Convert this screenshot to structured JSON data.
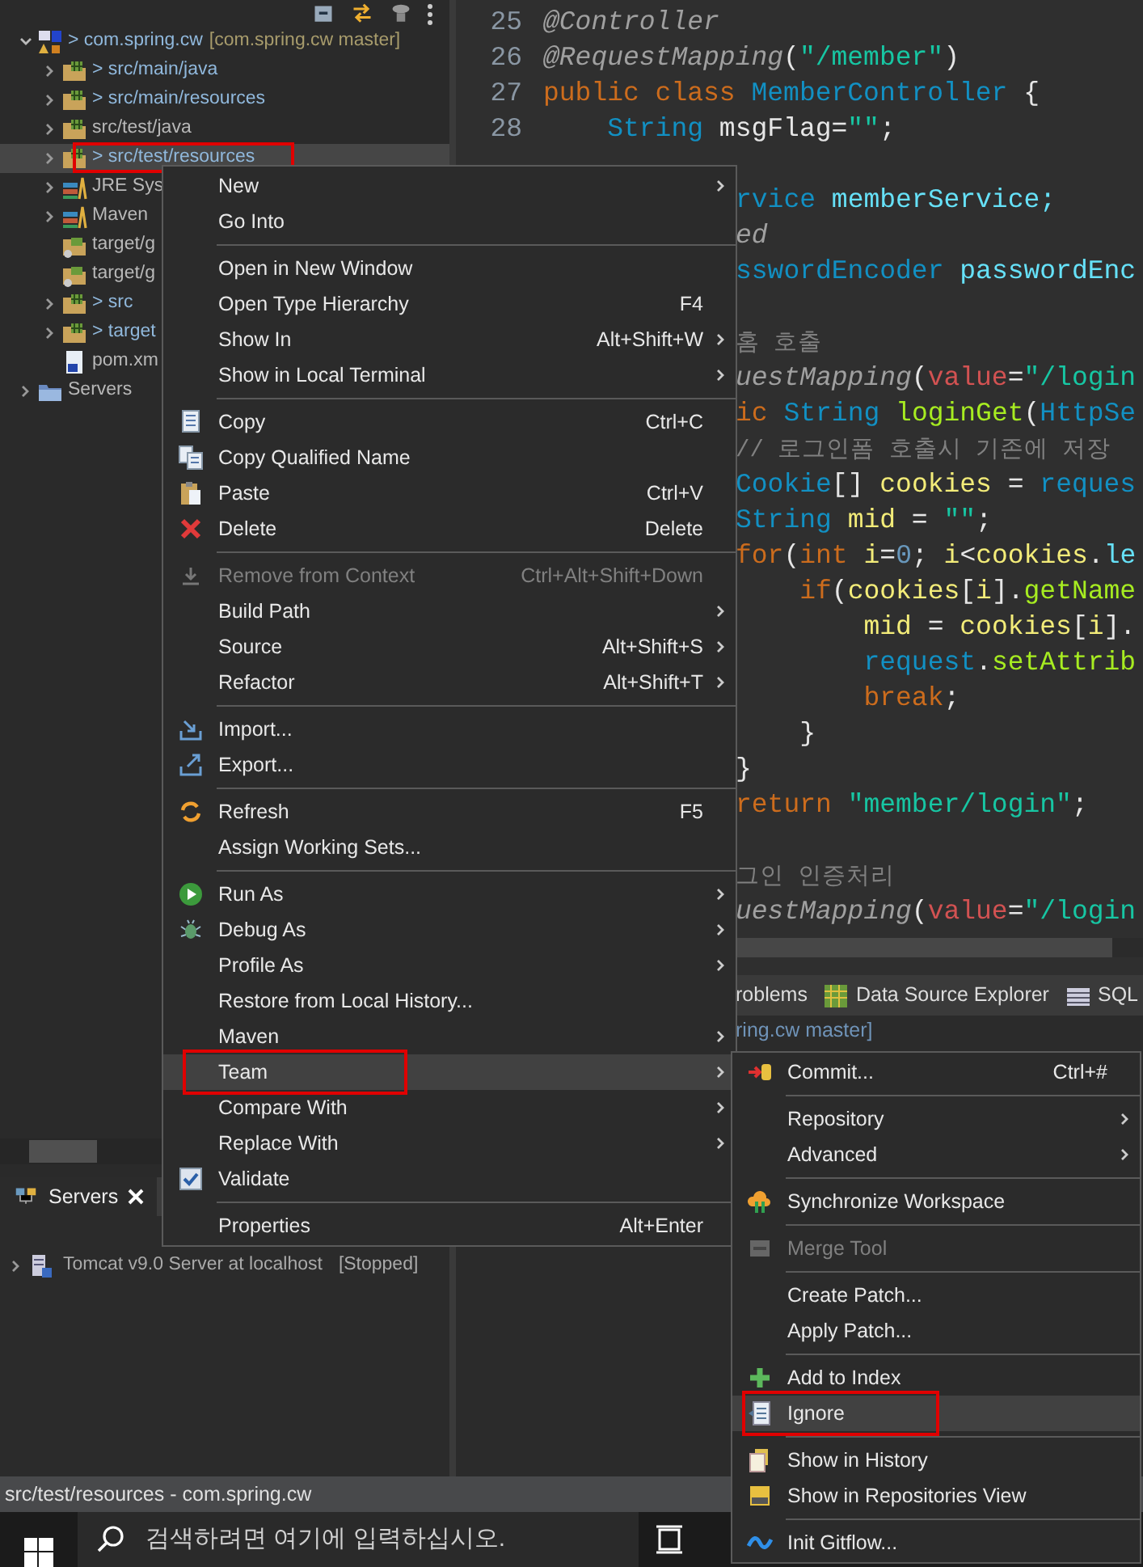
{
  "explorer": {
    "tree": [
      {
        "label": "> com.spring.cw",
        "suffix": "[com.spring.cw master]",
        "expanded": true,
        "kind": "changed",
        "selected": false,
        "annotated": false,
        "children": [
          {
            "label": "> src/main/java",
            "expanded": false,
            "kind": "changed",
            "selected": false,
            "annotated": false
          },
          {
            "label": "> src/main/resources",
            "expanded": false,
            "kind": "changed",
            "selected": false,
            "annotated": false
          },
          {
            "label": "src/test/java",
            "expanded": false,
            "kind": "plain",
            "selected": false,
            "annotated": false
          },
          {
            "label": "> src/test/resources",
            "expanded": false,
            "kind": "changed",
            "selected": true,
            "annotated": true
          },
          {
            "label": "JRE Sys",
            "expanded": false,
            "kind": "plain",
            "selected": false,
            "annotated": false
          },
          {
            "label": "Maven",
            "expanded": false,
            "kind": "plain",
            "selected": false,
            "annotated": false
          },
          {
            "label": "target/g",
            "kind": "plain",
            "selected": false,
            "annotated": false
          },
          {
            "label": "target/g",
            "kind": "plain",
            "selected": false,
            "annotated": false
          },
          {
            "label": "> src",
            "expanded": false,
            "kind": "changed",
            "selected": false,
            "annotated": false
          },
          {
            "label": "> target",
            "expanded": false,
            "kind": "changed",
            "selected": false,
            "annotated": false
          },
          {
            "label": "pom.xm",
            "kind": "plain",
            "selected": false,
            "annotated": false
          }
        ]
      },
      {
        "label": "Servers",
        "expanded": false,
        "kind": "plain",
        "selected": false,
        "annotated": false
      }
    ]
  },
  "editor": {
    "lines": [
      {
        "kind": "code",
        "number": "25",
        "tokens": [
          {
            "text": "@Controller",
            "kind": "annotation"
          }
        ]
      },
      {
        "kind": "code",
        "number": "26",
        "tokens": [
          {
            "text": "@RequestMapping",
            "kind": "annotation"
          },
          {
            "text": "(",
            "kind": "plain"
          },
          {
            "text": "\"/member\"",
            "kind": "string"
          },
          {
            "text": ")",
            "kind": "plain"
          }
        ]
      },
      {
        "kind": "code",
        "number": "27",
        "tokens": [
          {
            "text": "public class ",
            "kind": "keyword"
          },
          {
            "text": "MemberController",
            "kind": "type"
          },
          {
            "text": " {",
            "kind": "plain"
          }
        ]
      },
      {
        "kind": "code",
        "number": "28",
        "tokens": [
          {
            "text": "    String",
            "kind": "type"
          },
          {
            "text": " msgFlag=",
            "kind": "plain"
          },
          {
            "text": "\"\"",
            "kind": "string"
          },
          {
            "text": ";",
            "kind": "plain"
          }
        ]
      },
      {
        "kind": "blank"
      },
      {
        "kind": "code",
        "tokens": [
          {
            "text": "rvice",
            "kind": "type"
          },
          {
            "text": " memberService;",
            "kind": "field"
          }
        ]
      },
      {
        "kind": "code",
        "tokens": [
          {
            "text": "ed",
            "kind": "annotation"
          }
        ]
      },
      {
        "kind": "code",
        "tokens": [
          {
            "text": "sswordEncoder",
            "kind": "type"
          },
          {
            "text": " passwordEnc",
            "kind": "field"
          }
        ]
      },
      {
        "kind": "blank"
      },
      {
        "kind": "code",
        "tokens": [
          {
            "text": "홈 호출",
            "kind": "comment"
          }
        ]
      },
      {
        "kind": "code",
        "tokens": [
          {
            "text": "uestMapping",
            "kind": "annotation"
          },
          {
            "text": "(",
            "kind": "plain"
          },
          {
            "text": "value",
            "kind": "attr"
          },
          {
            "text": "=",
            "kind": "plain"
          },
          {
            "text": "\"/login",
            "kind": "string"
          }
        ]
      },
      {
        "kind": "code",
        "tokens": [
          {
            "text": "ic ",
            "kind": "keyword"
          },
          {
            "text": "String",
            "kind": "type"
          },
          {
            "text": " loginGet",
            "kind": "method"
          },
          {
            "text": "(",
            "kind": "plain"
          },
          {
            "text": "HttpSe",
            "kind": "type"
          }
        ]
      },
      {
        "kind": "code",
        "tokens": [
          {
            "text": "// 로그인폼 호출시 기존에 저장",
            "kind": "comment"
          }
        ]
      },
      {
        "kind": "code",
        "tokens": [
          {
            "text": "Cookie",
            "kind": "type"
          },
          {
            "text": "[] ",
            "kind": "plain"
          },
          {
            "text": "cookies",
            "kind": "local"
          },
          {
            "text": " = ",
            "kind": "plain"
          },
          {
            "text": "reques",
            "kind": "type"
          }
        ]
      },
      {
        "kind": "code",
        "tokens": [
          {
            "text": "String",
            "kind": "type"
          },
          {
            "text": " mid",
            "kind": "local"
          },
          {
            "text": " = ",
            "kind": "plain"
          },
          {
            "text": "\"\"",
            "kind": "string"
          },
          {
            "text": ";",
            "kind": "plain"
          }
        ]
      },
      {
        "kind": "code",
        "tokens": [
          {
            "text": "for",
            "kind": "keyword"
          },
          {
            "text": "(",
            "kind": "plain"
          },
          {
            "text": "int",
            "kind": "keyword"
          },
          {
            "text": " i",
            "kind": "local"
          },
          {
            "text": "=",
            "kind": "plain"
          },
          {
            "text": "0",
            "kind": "number"
          },
          {
            "text": "; ",
            "kind": "plain"
          },
          {
            "text": "i",
            "kind": "local"
          },
          {
            "text": "<",
            "kind": "plain"
          },
          {
            "text": "cookies",
            "kind": "local"
          },
          {
            "text": ".",
            "kind": "plain"
          },
          {
            "text": "le",
            "kind": "field"
          }
        ]
      },
      {
        "kind": "code",
        "tokens": [
          {
            "text": "    if",
            "kind": "keyword"
          },
          {
            "text": "(",
            "kind": "plain"
          },
          {
            "text": "cookies",
            "kind": "local"
          },
          {
            "text": "[",
            "kind": "plain"
          },
          {
            "text": "i",
            "kind": "local"
          },
          {
            "text": "].",
            "kind": "plain"
          },
          {
            "text": "getName",
            "kind": "method"
          }
        ]
      },
      {
        "kind": "code",
        "tokens": [
          {
            "text": "        mid",
            "kind": "local"
          },
          {
            "text": " = ",
            "kind": "plain"
          },
          {
            "text": "cookies",
            "kind": "local"
          },
          {
            "text": "[",
            "kind": "plain"
          },
          {
            "text": "i",
            "kind": "local"
          },
          {
            "text": "].",
            "kind": "plain"
          }
        ]
      },
      {
        "kind": "code",
        "tokens": [
          {
            "text": "        request",
            "kind": "type"
          },
          {
            "text": ".",
            "kind": "plain"
          },
          {
            "text": "setAttrib",
            "kind": "method"
          }
        ]
      },
      {
        "kind": "code",
        "tokens": [
          {
            "text": "        break",
            "kind": "keyword"
          },
          {
            "text": ";",
            "kind": "plain"
          }
        ]
      },
      {
        "kind": "code",
        "tokens": [
          {
            "text": "    }",
            "kind": "plain"
          }
        ]
      },
      {
        "kind": "code",
        "tokens": [
          {
            "text": "}",
            "kind": "plain"
          }
        ]
      },
      {
        "kind": "code",
        "tokens": [
          {
            "text": "return ",
            "kind": "keyword"
          },
          {
            "text": "\"member/login\"",
            "kind": "string"
          },
          {
            "text": ";",
            "kind": "plain"
          }
        ]
      },
      {
        "kind": "blank"
      },
      {
        "kind": "code",
        "tokens": [
          {
            "text": "그인 인증처리",
            "kind": "comment"
          }
        ]
      },
      {
        "kind": "code",
        "tokens": [
          {
            "text": "uestMapping",
            "kind": "annotation"
          },
          {
            "text": "(",
            "kind": "plain"
          },
          {
            "text": "value",
            "kind": "attr"
          },
          {
            "text": "=",
            "kind": "plain"
          },
          {
            "text": "\"/login",
            "kind": "string"
          }
        ]
      }
    ]
  },
  "bottom_panel": {
    "tabs": [
      {
        "label": "roblems",
        "selected": false
      },
      {
        "label": "Data Source Explorer",
        "selected": false
      },
      {
        "label": "SQL",
        "selected": false
      }
    ],
    "text": "ring.cw master]"
  },
  "servers_view": {
    "tab": {
      "label": "Servers",
      "selected": true
    },
    "rows": [
      {
        "label": "Tomcat v9.0 Server at localhost",
        "state": "[Stopped]",
        "expanded": false
      }
    ]
  },
  "context_menu": {
    "groups": [
      [
        {
          "label": "New",
          "submenu": true,
          "disabled": false,
          "selected": false
        },
        {
          "label": "Go Into",
          "disabled": false,
          "selected": false
        }
      ],
      [
        {
          "label": "Open in New Window",
          "disabled": false,
          "selected": false
        },
        {
          "label": "Open Type Hierarchy",
          "shortcut": "F4",
          "disabled": false,
          "selected": false
        },
        {
          "label": "Show In",
          "shortcut": "Alt+Shift+W",
          "submenu": true,
          "disabled": false,
          "selected": false
        },
        {
          "label": "Show in Local Terminal",
          "submenu": true,
          "disabled": false,
          "selected": false
        }
      ],
      [
        {
          "label": "Copy",
          "shortcut": "Ctrl+C",
          "disabled": false,
          "selected": false
        },
        {
          "label": "Copy Qualified Name",
          "disabled": false,
          "selected": false
        },
        {
          "label": "Paste",
          "shortcut": "Ctrl+V",
          "disabled": false,
          "selected": false
        },
        {
          "label": "Delete",
          "shortcut": "Delete",
          "disabled": false,
          "selected": false
        }
      ],
      [
        {
          "label": "Remove from Context",
          "shortcut": "Ctrl+Alt+Shift+Down",
          "disabled": true,
          "selected": false
        },
        {
          "label": "Build Path",
          "submenu": true,
          "disabled": false,
          "selected": false
        },
        {
          "label": "Source",
          "shortcut": "Alt+Shift+S",
          "submenu": true,
          "disabled": false,
          "selected": false
        },
        {
          "label": "Refactor",
          "shortcut": "Alt+Shift+T",
          "submenu": true,
          "disabled": false,
          "selected": false
        }
      ],
      [
        {
          "label": "Import...",
          "disabled": false,
          "selected": false
        },
        {
          "label": "Export...",
          "disabled": false,
          "selected": false
        }
      ],
      [
        {
          "label": "Refresh",
          "shortcut": "F5",
          "disabled": false,
          "selected": false
        },
        {
          "label": "Assign Working Sets...",
          "disabled": false,
          "selected": false
        }
      ],
      [
        {
          "label": "Run As",
          "submenu": true,
          "disabled": false,
          "selected": false
        },
        {
          "label": "Debug As",
          "submenu": true,
          "disabled": false,
          "selected": false
        },
        {
          "label": "Profile As",
          "submenu": true,
          "disabled": false,
          "selected": false
        },
        {
          "label": "Restore from Local History...",
          "disabled": false,
          "selected": false
        },
        {
          "label": "Maven",
          "submenu": true,
          "disabled": false,
          "selected": false
        },
        {
          "label": "Team",
          "submenu": true,
          "disabled": false,
          "selected": true,
          "annotated": true
        },
        {
          "label": "Compare With",
          "submenu": true,
          "disabled": false,
          "selected": false
        },
        {
          "label": "Replace With",
          "submenu": true,
          "disabled": false,
          "selected": false
        },
        {
          "label": "Validate",
          "disabled": false,
          "selected": false,
          "checked": true
        }
      ],
      [
        {
          "label": "Properties",
          "shortcut": "Alt+Enter",
          "disabled": false,
          "selected": false
        }
      ]
    ]
  },
  "team_submenu": {
    "groups": [
      [
        {
          "label": "Commit...",
          "shortcut": "Ctrl+#",
          "disabled": false,
          "selected": false
        }
      ],
      [
        {
          "label": "Repository",
          "submenu": true,
          "disabled": false,
          "selected": false
        },
        {
          "label": "Advanced",
          "submenu": true,
          "disabled": false,
          "selected": false
        }
      ],
      [
        {
          "label": "Synchronize Workspace",
          "disabled": false,
          "selected": false
        }
      ],
      [
        {
          "label": "Merge Tool",
          "disabled": true,
          "selected": false
        }
      ],
      [
        {
          "label": "Create Patch...",
          "disabled": false,
          "selected": false
        },
        {
          "label": "Apply Patch...",
          "disabled": false,
          "selected": false
        }
      ],
      [
        {
          "label": "Add to Index",
          "disabled": false,
          "selected": false
        },
        {
          "label": "Ignore",
          "disabled": false,
          "selected": true,
          "annotated": true
        }
      ],
      [
        {
          "label": "Show in History",
          "disabled": false,
          "selected": false
        },
        {
          "label": "Show in Repositories View",
          "disabled": false,
          "selected": false
        }
      ],
      [
        {
          "label": "Init Gitflow...",
          "disabled": false,
          "selected": false
        }
      ]
    ]
  },
  "status_bar": {
    "text": "src/test/resources - com.spring.cw"
  },
  "taskbar": {
    "search": {
      "placeholder": "검색하려면 여기에 입력하십시오."
    }
  }
}
